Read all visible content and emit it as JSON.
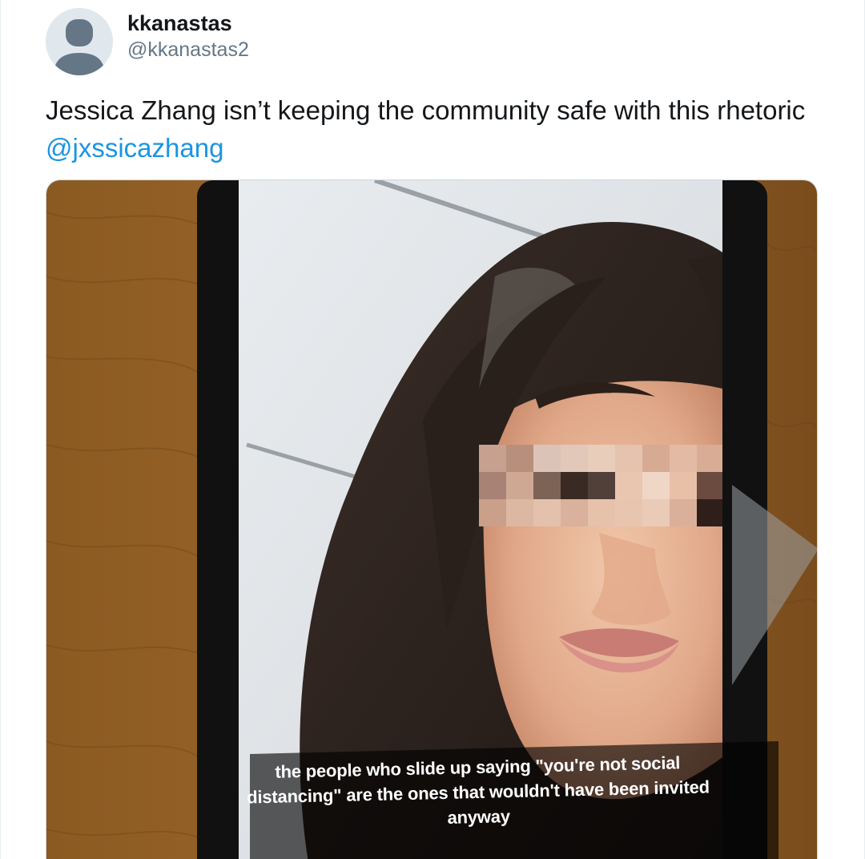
{
  "tweet": {
    "author": {
      "display_name": "kkanastas",
      "handle": "@kkanastas2"
    },
    "text": {
      "body": "Jessica Zhang isn’t keeping the community safe with this rhetoric ",
      "mention": "@jxssicazhang"
    },
    "media": {
      "caption": "the people who slide up saying \"you're not social distancing\" are the ones that wouldn't have been invited anyway"
    }
  },
  "colors": {
    "link": "#1b95e0",
    "secondary_text": "#657786",
    "primary_text": "#14171a"
  }
}
